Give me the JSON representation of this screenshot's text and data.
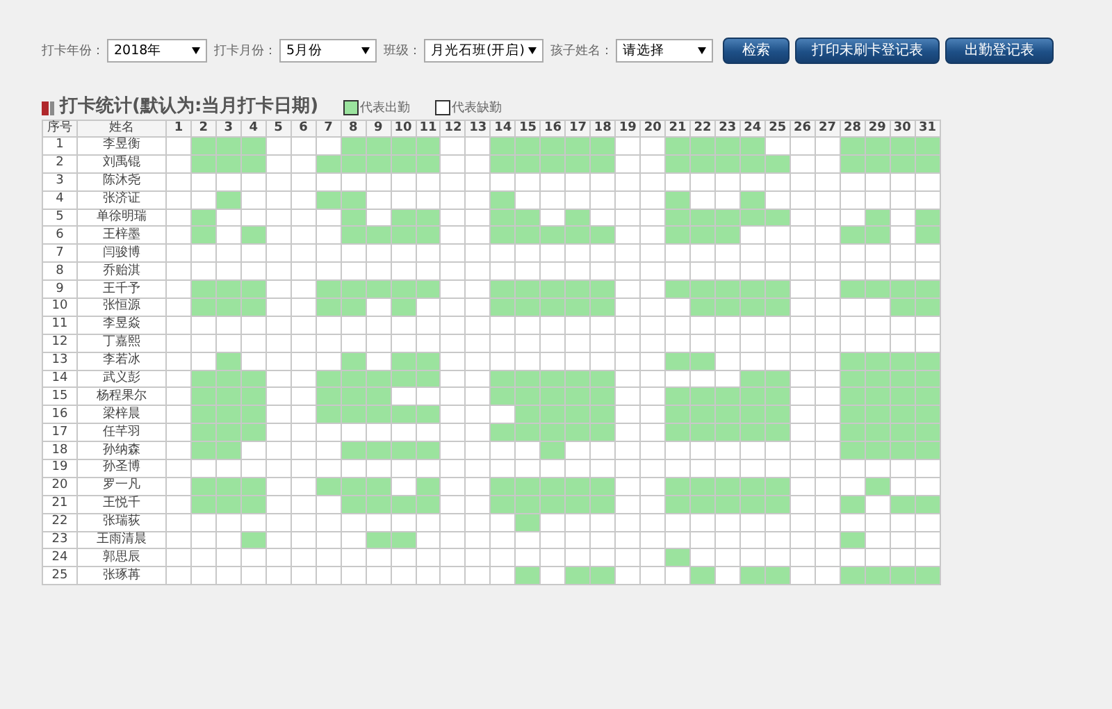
{
  "filters": [
    {
      "label": "打卡年份：",
      "value": "2018年"
    },
    {
      "label": "打卡月份：",
      "value": "5月份"
    },
    {
      "label": "班级：",
      "value": "月光石班(开启)"
    },
    {
      "label": "孩子姓名：",
      "value": "请选择"
    }
  ],
  "buttons": [
    "检索",
    "打印未刷卡登记表",
    "出勤登记表"
  ],
  "title": "打卡统计(默认为:当月打卡日期)",
  "legend": [
    {
      "label": "代表出勤",
      "present": true
    },
    {
      "label": "代表缺勤",
      "present": false
    }
  ],
  "columns": [
    "序号",
    "姓名"
  ],
  "day_headers": [
    "1",
    "2",
    "3",
    "4",
    "5",
    "6",
    "7",
    "8",
    "9",
    "10",
    "11",
    "12",
    "13",
    "14",
    "15",
    "16",
    "17",
    "18",
    "19",
    "20",
    "21",
    "22",
    "23",
    "24",
    "25",
    "26",
    "27",
    "28",
    "29",
    "30",
    "31"
  ],
  "rows": [
    {
      "no": "1",
      "name": "李昱衡",
      "days": [
        false,
        true,
        true,
        true,
        false,
        false,
        false,
        true,
        true,
        true,
        true,
        false,
        false,
        true,
        true,
        true,
        true,
        true,
        false,
        false,
        true,
        true,
        true,
        true,
        false,
        false,
        false,
        true,
        true,
        true,
        true
      ]
    },
    {
      "no": "2",
      "name": "刘禹锟",
      "days": [
        false,
        true,
        true,
        true,
        false,
        false,
        true,
        true,
        true,
        true,
        true,
        false,
        false,
        true,
        true,
        true,
        true,
        true,
        false,
        false,
        true,
        true,
        true,
        true,
        true,
        false,
        false,
        true,
        true,
        true,
        true
      ]
    },
    {
      "no": "3",
      "name": "陈沐尧",
      "days": [
        false,
        false,
        false,
        false,
        false,
        false,
        false,
        false,
        false,
        false,
        false,
        false,
        false,
        false,
        false,
        false,
        false,
        false,
        false,
        false,
        false,
        false,
        false,
        false,
        false,
        false,
        false,
        false,
        false,
        false,
        false
      ]
    },
    {
      "no": "4",
      "name": "张济证",
      "days": [
        false,
        false,
        true,
        false,
        false,
        false,
        true,
        true,
        false,
        false,
        false,
        false,
        false,
        true,
        false,
        false,
        false,
        false,
        false,
        false,
        true,
        false,
        false,
        true,
        false,
        false,
        false,
        false,
        false,
        false,
        false
      ]
    },
    {
      "no": "5",
      "name": "单徐明瑞",
      "days": [
        false,
        true,
        false,
        false,
        false,
        false,
        false,
        true,
        false,
        true,
        true,
        false,
        false,
        true,
        true,
        false,
        true,
        false,
        false,
        false,
        true,
        true,
        true,
        true,
        true,
        false,
        false,
        false,
        true,
        false,
        true
      ]
    },
    {
      "no": "6",
      "name": "王梓墨",
      "days": [
        false,
        true,
        false,
        true,
        false,
        false,
        false,
        true,
        true,
        true,
        true,
        false,
        false,
        true,
        true,
        true,
        true,
        true,
        false,
        false,
        true,
        true,
        true,
        false,
        false,
        false,
        false,
        true,
        true,
        false,
        true
      ]
    },
    {
      "no": "7",
      "name": "闫骏博",
      "days": [
        false,
        false,
        false,
        false,
        false,
        false,
        false,
        false,
        false,
        false,
        false,
        false,
        false,
        false,
        false,
        false,
        false,
        false,
        false,
        false,
        false,
        false,
        false,
        false,
        false,
        false,
        false,
        false,
        false,
        false,
        false
      ]
    },
    {
      "no": "8",
      "name": "乔贻淇",
      "days": [
        false,
        false,
        false,
        false,
        false,
        false,
        false,
        false,
        false,
        false,
        false,
        false,
        false,
        false,
        false,
        false,
        false,
        false,
        false,
        false,
        false,
        false,
        false,
        false,
        false,
        false,
        false,
        false,
        false,
        false,
        false
      ]
    },
    {
      "no": "9",
      "name": "王千予",
      "days": [
        false,
        true,
        true,
        true,
        false,
        false,
        true,
        true,
        true,
        true,
        true,
        false,
        false,
        true,
        true,
        true,
        true,
        true,
        false,
        false,
        true,
        true,
        true,
        true,
        true,
        false,
        false,
        true,
        true,
        true,
        true
      ]
    },
    {
      "no": "10",
      "name": "张恒源",
      "days": [
        false,
        true,
        true,
        true,
        false,
        false,
        true,
        true,
        false,
        true,
        false,
        false,
        false,
        true,
        true,
        true,
        true,
        true,
        false,
        false,
        false,
        true,
        true,
        true,
        true,
        false,
        false,
        false,
        false,
        true,
        true
      ]
    },
    {
      "no": "11",
      "name": "李昱焱",
      "days": [
        false,
        false,
        false,
        false,
        false,
        false,
        false,
        false,
        false,
        false,
        false,
        false,
        false,
        false,
        false,
        false,
        false,
        false,
        false,
        false,
        false,
        false,
        false,
        false,
        false,
        false,
        false,
        false,
        false,
        false,
        false
      ]
    },
    {
      "no": "12",
      "name": "丁嘉熙",
      "days": [
        false,
        false,
        false,
        false,
        false,
        false,
        false,
        false,
        false,
        false,
        false,
        false,
        false,
        false,
        false,
        false,
        false,
        false,
        false,
        false,
        false,
        false,
        false,
        false,
        false,
        false,
        false,
        false,
        false,
        false,
        false
      ]
    },
    {
      "no": "13",
      "name": "李若冰",
      "days": [
        false,
        false,
        true,
        false,
        false,
        false,
        false,
        true,
        false,
        true,
        true,
        false,
        false,
        false,
        false,
        false,
        false,
        false,
        false,
        false,
        true,
        true,
        false,
        false,
        false,
        false,
        false,
        true,
        true,
        true,
        true
      ]
    },
    {
      "no": "14",
      "name": "武义彭",
      "days": [
        false,
        true,
        true,
        true,
        false,
        false,
        true,
        true,
        true,
        true,
        true,
        false,
        false,
        true,
        true,
        true,
        true,
        true,
        false,
        false,
        false,
        false,
        false,
        true,
        true,
        false,
        false,
        true,
        true,
        true,
        true
      ]
    },
    {
      "no": "15",
      "name": "杨程果尔",
      "days": [
        false,
        true,
        true,
        true,
        false,
        false,
        true,
        true,
        true,
        false,
        false,
        false,
        false,
        true,
        true,
        true,
        true,
        true,
        false,
        false,
        true,
        true,
        true,
        true,
        true,
        false,
        false,
        true,
        true,
        true,
        true
      ]
    },
    {
      "no": "16",
      "name": "梁梓晨",
      "days": [
        false,
        true,
        true,
        true,
        false,
        false,
        true,
        true,
        true,
        true,
        true,
        false,
        false,
        false,
        true,
        true,
        true,
        true,
        false,
        false,
        true,
        true,
        true,
        true,
        true,
        false,
        false,
        true,
        true,
        true,
        true
      ]
    },
    {
      "no": "17",
      "name": "任芊羽",
      "days": [
        false,
        true,
        true,
        true,
        false,
        false,
        false,
        false,
        false,
        false,
        false,
        false,
        false,
        true,
        true,
        true,
        true,
        true,
        false,
        false,
        true,
        true,
        true,
        true,
        true,
        false,
        false,
        true,
        true,
        true,
        true
      ]
    },
    {
      "no": "18",
      "name": "孙纳森",
      "days": [
        false,
        true,
        true,
        false,
        false,
        false,
        false,
        true,
        true,
        true,
        true,
        false,
        false,
        false,
        false,
        true,
        false,
        false,
        false,
        false,
        false,
        false,
        false,
        false,
        false,
        false,
        false,
        true,
        true,
        true,
        true
      ]
    },
    {
      "no": "19",
      "name": "孙圣博",
      "days": [
        false,
        false,
        false,
        false,
        false,
        false,
        false,
        false,
        false,
        false,
        false,
        false,
        false,
        false,
        false,
        false,
        false,
        false,
        false,
        false,
        false,
        false,
        false,
        false,
        false,
        false,
        false,
        false,
        false,
        false,
        false
      ]
    },
    {
      "no": "20",
      "name": "罗一凡",
      "days": [
        false,
        true,
        true,
        true,
        false,
        false,
        true,
        true,
        true,
        false,
        true,
        false,
        false,
        true,
        true,
        true,
        true,
        true,
        false,
        false,
        true,
        true,
        true,
        true,
        true,
        false,
        false,
        false,
        true,
        false,
        false
      ]
    },
    {
      "no": "21",
      "name": "王悦千",
      "days": [
        false,
        true,
        true,
        true,
        false,
        false,
        false,
        true,
        true,
        true,
        true,
        false,
        false,
        true,
        true,
        true,
        true,
        true,
        false,
        false,
        true,
        true,
        true,
        true,
        true,
        false,
        false,
        true,
        false,
        true,
        true
      ]
    },
    {
      "no": "22",
      "name": "张瑞荻",
      "days": [
        false,
        false,
        false,
        false,
        false,
        false,
        false,
        false,
        false,
        false,
        false,
        false,
        false,
        false,
        true,
        false,
        false,
        false,
        false,
        false,
        false,
        false,
        false,
        false,
        false,
        false,
        false,
        false,
        false,
        false,
        false
      ]
    },
    {
      "no": "23",
      "name": "王雨清晨",
      "days": [
        false,
        false,
        false,
        true,
        false,
        false,
        false,
        false,
        true,
        true,
        false,
        false,
        false,
        false,
        false,
        false,
        false,
        false,
        false,
        false,
        false,
        false,
        false,
        false,
        false,
        false,
        false,
        true,
        false,
        false,
        false
      ]
    },
    {
      "no": "24",
      "name": "郭思辰",
      "days": [
        false,
        false,
        false,
        false,
        false,
        false,
        false,
        false,
        false,
        false,
        false,
        false,
        false,
        false,
        false,
        false,
        false,
        false,
        false,
        false,
        true,
        false,
        false,
        false,
        false,
        false,
        false,
        false,
        false,
        false,
        false
      ]
    },
    {
      "no": "25",
      "name": "张琢苒",
      "days": [
        false,
        false,
        false,
        false,
        false,
        false,
        false,
        false,
        false,
        false,
        false,
        false,
        false,
        false,
        true,
        false,
        true,
        true,
        false,
        false,
        false,
        true,
        false,
        true,
        true,
        false,
        false,
        true,
        true,
        true,
        true
      ]
    }
  ]
}
